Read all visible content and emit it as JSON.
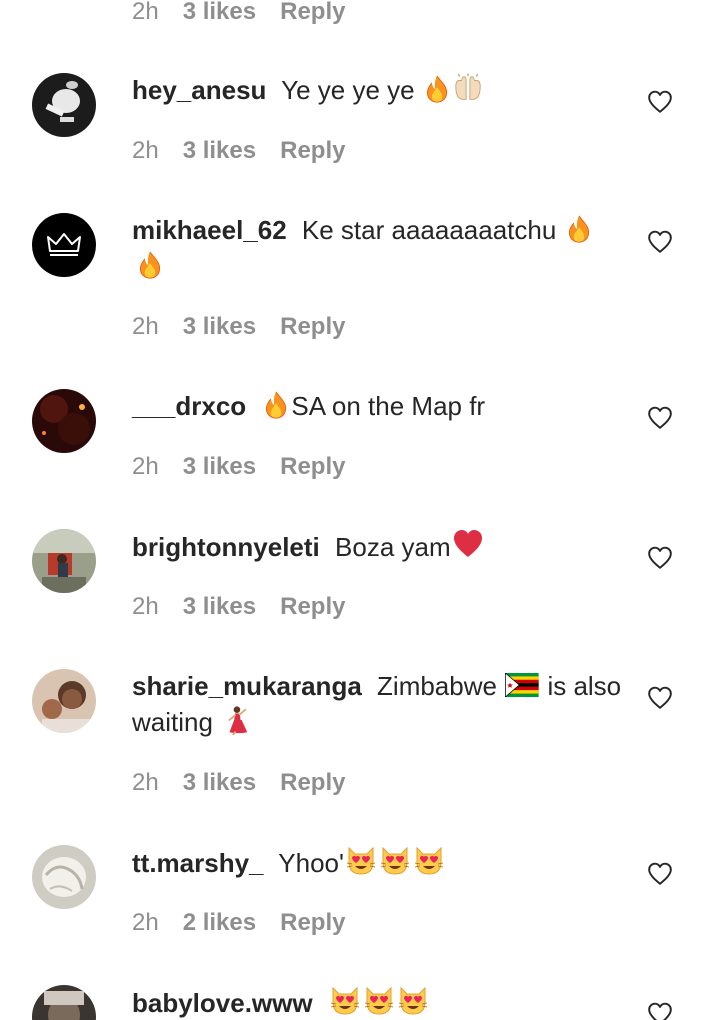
{
  "top_meta": {
    "time": "2h",
    "likes": "3 likes",
    "reply": "Reply"
  },
  "comments": [
    {
      "username": "hey_anesu",
      "text": "Ye ye ye ye",
      "time": "2h",
      "likes": "3 likes",
      "reply": "Reply",
      "emojis": [
        "fire",
        "raised-hands"
      ]
    },
    {
      "username": "mikhaeel_62",
      "text": "Ke star aaaaaaaatchu",
      "time": "2h",
      "likes": "3 likes",
      "reply": "Reply",
      "emojis": [
        "fire",
        "fire"
      ]
    },
    {
      "username": "___drxco",
      "text": "SA on the Map fr",
      "time": "2h",
      "likes": "3 likes",
      "reply": "Reply",
      "emojis": [
        "fire"
      ]
    },
    {
      "username": "brightonnyeleti",
      "text": "Boza yam",
      "time": "2h",
      "likes": "3 likes",
      "reply": "Reply",
      "emojis": [
        "red-heart"
      ]
    },
    {
      "username": "sharie_mukaranga",
      "text_part1": "Zimbabwe",
      "text_part2": "is also waiting",
      "time": "2h",
      "likes": "3 likes",
      "reply": "Reply",
      "emojis": [
        "zimbabwe-flag",
        "dancer"
      ]
    },
    {
      "username": "tt.marshy_",
      "text": "Yhoo'",
      "time": "2h",
      "likes": "2 likes",
      "reply": "Reply",
      "emojis": [
        "heart-eyes-cat",
        "heart-eyes-cat",
        "heart-eyes-cat"
      ]
    },
    {
      "username": "babylove.www",
      "text": "",
      "emojis": [
        "heart-eyes-cat",
        "heart-eyes-cat",
        "heart-eyes-cat"
      ]
    }
  ],
  "colors": {
    "text": "#262626",
    "secondary": "#8e8e8e",
    "background": "#ffffff",
    "heart_red": "#ed1c24",
    "fire_orange": "#f7931e"
  }
}
